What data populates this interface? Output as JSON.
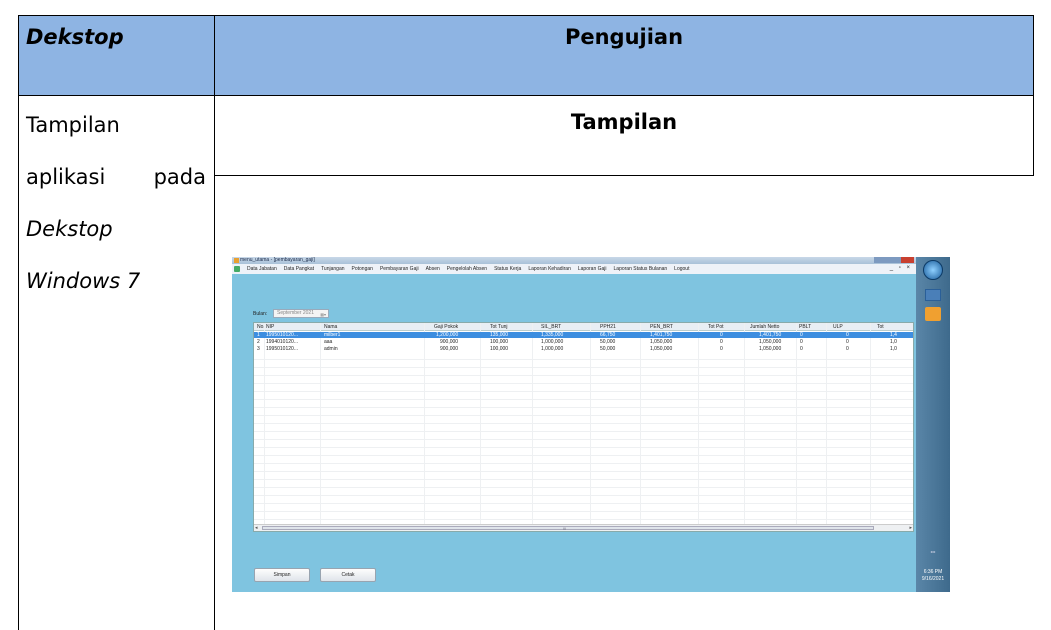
{
  "document": {
    "header_left": "Dekstop",
    "header_right": "Pengujian",
    "left_cell": {
      "line1": "Tampilan",
      "line2_a": "aplikasi",
      "line2_b": "pada",
      "line3": "Dekstop",
      "line4": "Windows 7"
    },
    "right_subtitle": "Tampilan"
  },
  "app": {
    "window_title": "menu_utama - [pembayaran_gaji]",
    "menu": [
      "Data Jabatan",
      "Data Pangkat",
      "Tunjangan",
      "Potongan",
      "Pembayaran Gaji",
      "Absen",
      "Pengelolah Absen",
      "Status Kerja",
      "Laporan Kehadiran",
      "Laporan Gaji",
      "Laporan Status Bulanan",
      "Logout"
    ],
    "mdi_controls": "_ ▫ ×",
    "bulan_label": "Bulan:",
    "bulan_value": "September 2021",
    "columns": [
      "No.",
      "NIP",
      "Nama",
      "Gaji Pokok",
      "Tot Tunj",
      "SIL_BRT",
      "PPH21",
      "PEN_BRT",
      "Tot Pot",
      "Jumlah Netto",
      "PBLT",
      "ULP",
      "Tot"
    ],
    "rows": [
      [
        "1",
        "1995010120...",
        "milber1",
        "1,200,000",
        "135,000",
        "1,335,000",
        "66,750",
        "1,401,750",
        "0",
        "1,401,750",
        "0",
        "0",
        "1,4"
      ],
      [
        "2",
        "1994010120...",
        "aaa",
        "900,000",
        "100,000",
        "1,000,000",
        "50,000",
        "1,050,000",
        "0",
        "1,050,000",
        "0",
        "0",
        "1,0"
      ],
      [
        "3",
        "1995010120...",
        "admin",
        "900,000",
        "100,000",
        "1,000,000",
        "50,000",
        "1,050,000",
        "0",
        "1,050,000",
        "0",
        "0",
        "1,0"
      ]
    ],
    "selected_row": 0,
    "scroll_left": "◂",
    "scroll_mid": "III",
    "scroll_right": "▸",
    "button_simpan": "Simpan",
    "button_cetak": "Cetak"
  },
  "taskbar": {
    "time": "6:36 PM",
    "date": "9/16/2021"
  },
  "colors": {
    "header_bg": "#8eb4e3",
    "content_bg": "#7fc4e0",
    "selection": "#3d8ee0"
  }
}
